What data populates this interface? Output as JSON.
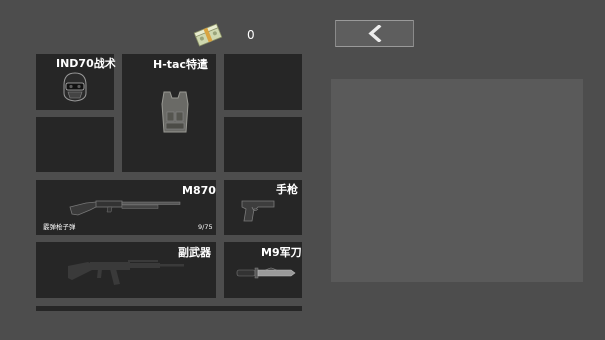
{
  "currency": {
    "amount": "0",
    "icon": "cash-stack-icon"
  },
  "back_button": {
    "icon": "chevron-left-icon"
  },
  "slots": {
    "helmet": {
      "label": "IND70战术",
      "icon": "tactical-helmet-icon"
    },
    "vest": {
      "label": "H-tac特遣",
      "icon": "tactical-vest-icon"
    },
    "primary": {
      "label": "M870",
      "icon": "shotgun-icon",
      "ammo_name": "霰弹枪子弹",
      "ammo_count": "9/75"
    },
    "pistol": {
      "label": "手枪",
      "icon": "pistol-icon"
    },
    "secondary": {
      "label": "副武器",
      "icon": "rifle-silhouette-icon"
    },
    "knife": {
      "label": "M9军刀",
      "icon": "combat-knife-icon"
    }
  },
  "colors": {
    "background": "#4d4d4d",
    "slot": "#262626",
    "panel": "#5a5a5a",
    "text": "#ffffff"
  }
}
